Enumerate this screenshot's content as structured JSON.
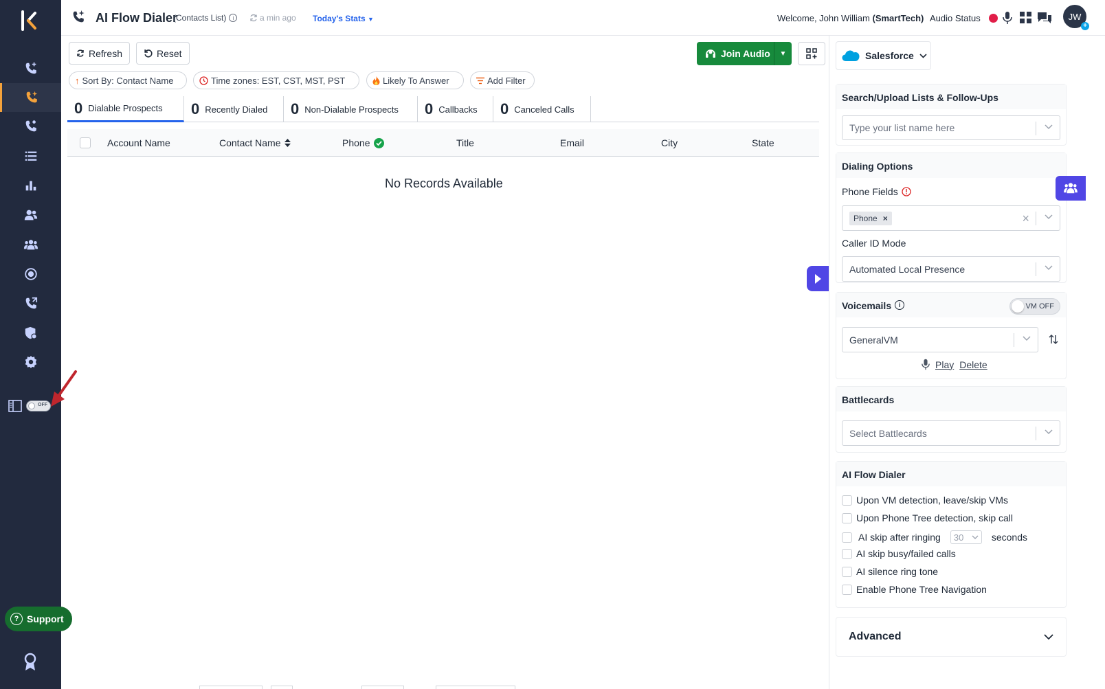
{
  "header": {
    "title": "AI Flow Dialer",
    "subtitle": "(Contacts List)",
    "updated": "a min ago",
    "stats_link": "Today's Stats",
    "welcome_prefix": "Welcome, John William",
    "welcome_company": "(SmartTech)",
    "audio_status_label": "Audio Status",
    "avatar_initials": "JW",
    "status_color": "#e11d48"
  },
  "toolbar": {
    "refresh_label": "Refresh",
    "reset_label": "Reset",
    "join_audio_label": "Join Audio"
  },
  "filters": {
    "sort": "Sort By: Contact Name",
    "timezones": "Time zones: EST, CST, MST, PST",
    "likely": "Likely To Answer",
    "add": "Add Filter"
  },
  "tabs": [
    {
      "count": "0",
      "label": "Dialable Prospects"
    },
    {
      "count": "0",
      "label": "Recently Dialed"
    },
    {
      "count": "0",
      "label": "Non-Dialable Prospects"
    },
    {
      "count": "0",
      "label": "Callbacks"
    },
    {
      "count": "0",
      "label": "Canceled Calls"
    }
  ],
  "table": {
    "columns": [
      "Account Name",
      "Contact Name",
      "Phone",
      "Title",
      "Email",
      "City",
      "State"
    ],
    "empty_message": "No Records Available"
  },
  "sidebar": {
    "panel_toggle": "OFF",
    "support_label": "Support",
    "accent": "#f4a23b"
  },
  "right_panel": {
    "crm_label": "Salesforce",
    "search_section": {
      "title": "Search/Upload Lists & Follow-Ups",
      "placeholder": "Type your list name here"
    },
    "dialing_options": {
      "title": "Dialing Options",
      "phone_fields_label": "Phone Fields",
      "phone_tag": "Phone",
      "caller_id_label": "Caller ID Mode",
      "caller_id_value": "Automated Local Presence"
    },
    "voicemails": {
      "title": "Voicemails",
      "toggle_text": "VM OFF",
      "selected": "GeneralVM",
      "play": "Play",
      "delete": "Delete"
    },
    "battlecards": {
      "title": "Battlecards",
      "placeholder": "Select Battlecards"
    },
    "ai_flow": {
      "title": "AI Flow Dialer",
      "opt1": "Upon VM detection, leave/skip VMs",
      "opt2": "Upon Phone Tree detection, skip call",
      "opt3_prefix": "AI skip after ringing",
      "opt3_value": "30",
      "opt3_suffix": "seconds",
      "opt4": "AI skip busy/failed calls",
      "opt5": "AI silence ring tone",
      "opt6": "Enable Phone Tree Navigation"
    },
    "advanced_label": "Advanced"
  }
}
